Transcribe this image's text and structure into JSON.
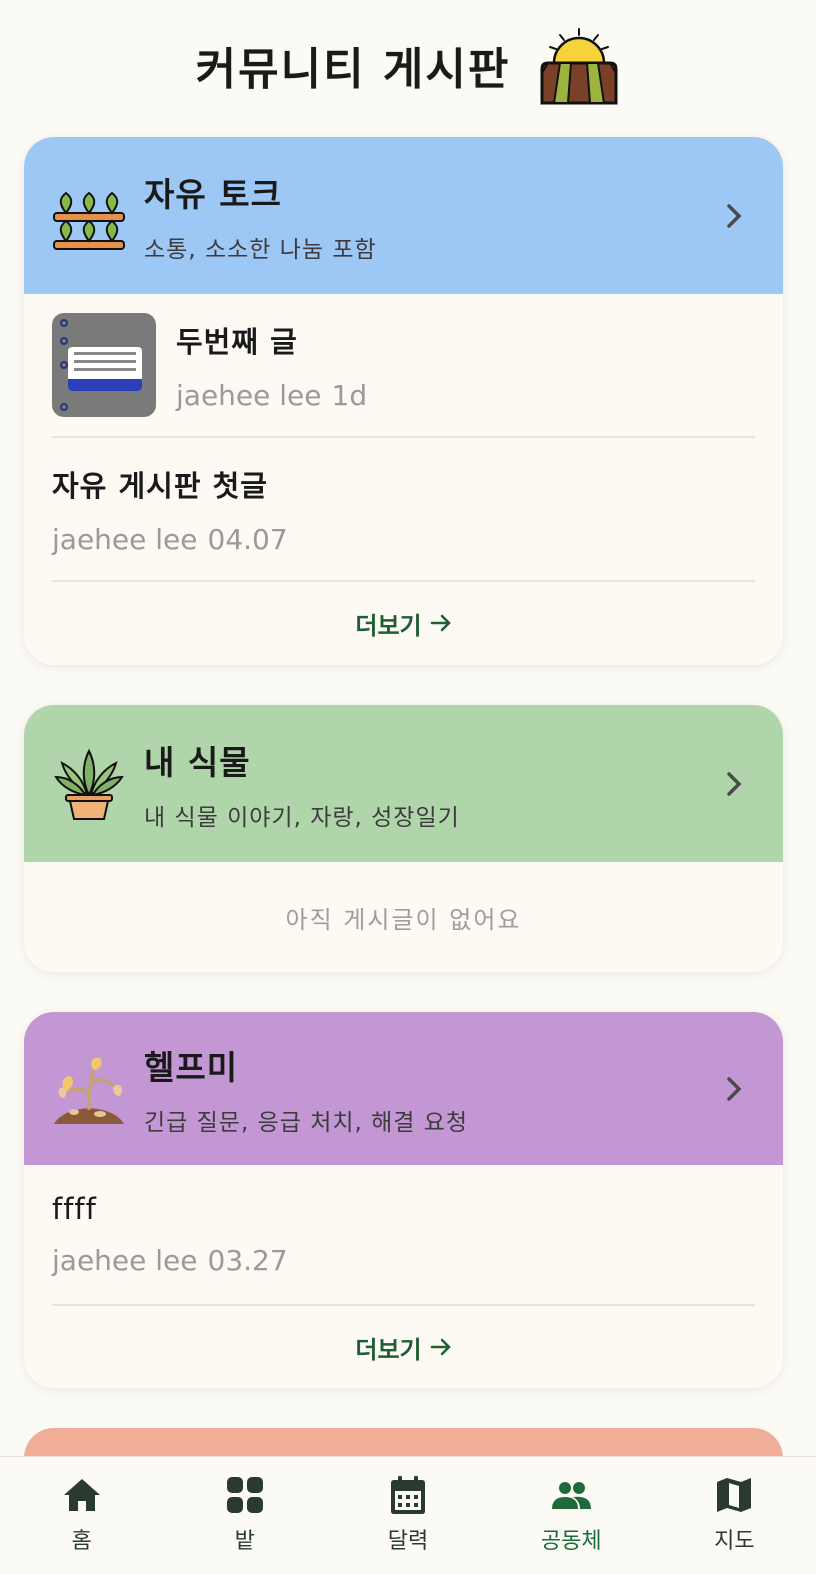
{
  "page": {
    "title": "커뮤니티 게시판",
    "header_icon": "farm-field-sun-icon"
  },
  "categories": [
    {
      "title": "자유 토크",
      "description": "소통, 소소한 나눔 포함",
      "color": "#9dc8f5",
      "icon": "seedling-rows-icon",
      "posts": [
        {
          "title": "두번째 글",
          "author": "jaehee lee",
          "time": "1d",
          "has_thumbnail": true
        },
        {
          "title": "자유 게시판 첫글",
          "author": "jaehee lee",
          "time": "04.07",
          "has_thumbnail": false
        }
      ],
      "more_label": "더보기"
    },
    {
      "title": "내 식물",
      "description": "내 식물 이야기, 자랑, 성장일기",
      "color": "#b0d5ab",
      "icon": "potted-plant-icon",
      "posts": [],
      "empty_label": "아직 게시글이 없어요"
    },
    {
      "title": "헬프미",
      "description": "긴급 질문, 응급 처치, 해결 요청",
      "color": "#c396d4",
      "icon": "wilted-plant-icon",
      "posts": [
        {
          "title": "ffff",
          "author": "jaehee lee",
          "time": "03.27",
          "has_thumbnail": false
        }
      ],
      "more_label": "더보기"
    },
    {
      "color": "#f0ad97"
    }
  ],
  "nav": {
    "items": [
      {
        "label": "홈",
        "icon": "home-icon",
        "active": false
      },
      {
        "label": "밭",
        "icon": "grid-icon",
        "active": false
      },
      {
        "label": "달력",
        "icon": "calendar-icon",
        "active": false
      },
      {
        "label": "공동체",
        "icon": "people-icon",
        "active": true
      },
      {
        "label": "지도",
        "icon": "map-icon",
        "active": false
      }
    ],
    "active_color": "#1f6a3a"
  }
}
